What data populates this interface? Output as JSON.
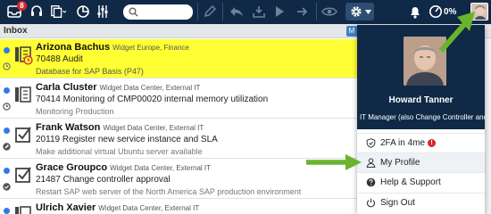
{
  "toolbar": {
    "inbox_badge": "8",
    "battery_percent": "0%",
    "colors": {
      "bar": "#0f2946",
      "badge": "#d9262e"
    }
  },
  "inbox": {
    "title": "Inbox",
    "tab_letter": "M"
  },
  "tasks": [
    {
      "name": "Arizona Bachus",
      "org": "Widget Europe, Finance",
      "line2": "70488 Audit",
      "line3": "Database for SAP Basis (P47)",
      "highlighted": true
    },
    {
      "name": "Carla Cluster",
      "org": "Widget Data Center, External IT",
      "line2": "70414 Monitoring of CMP00020 internal memory utilization",
      "line3": "Monitoring Production",
      "highlighted": false
    },
    {
      "name": "Frank Watson",
      "org": "Widget Data Center, External IT",
      "line2": "20119 Register new service instance and SLA",
      "line3": "Make additional virtual Ubuntu server available",
      "highlighted": false
    },
    {
      "name": "Grace Groupco",
      "org": "Widget Data Center, External IT",
      "line2": "21487 Change controller approval",
      "line3": "Restart SAP web server of the North America SAP production environment",
      "highlighted": false
    },
    {
      "name": "Ulrich Xavier",
      "org": "Widget Data Center, External IT",
      "line2": "",
      "line3": "",
      "highlighted": false
    }
  ],
  "profile_menu": {
    "user_name": "Howard Tanner",
    "user_role": "IT Manager (also Change Controller and Op...",
    "items": [
      {
        "label": "2FA in 4me",
        "badge": "!",
        "icon": "shield-check-icon"
      },
      {
        "label": "My Profile",
        "icon": "person-icon"
      },
      {
        "label": "Help & Support",
        "icon": "question-circle-icon"
      },
      {
        "label": "Sign Out",
        "icon": "power-icon"
      }
    ]
  },
  "annotation_color": "#6ab42d"
}
